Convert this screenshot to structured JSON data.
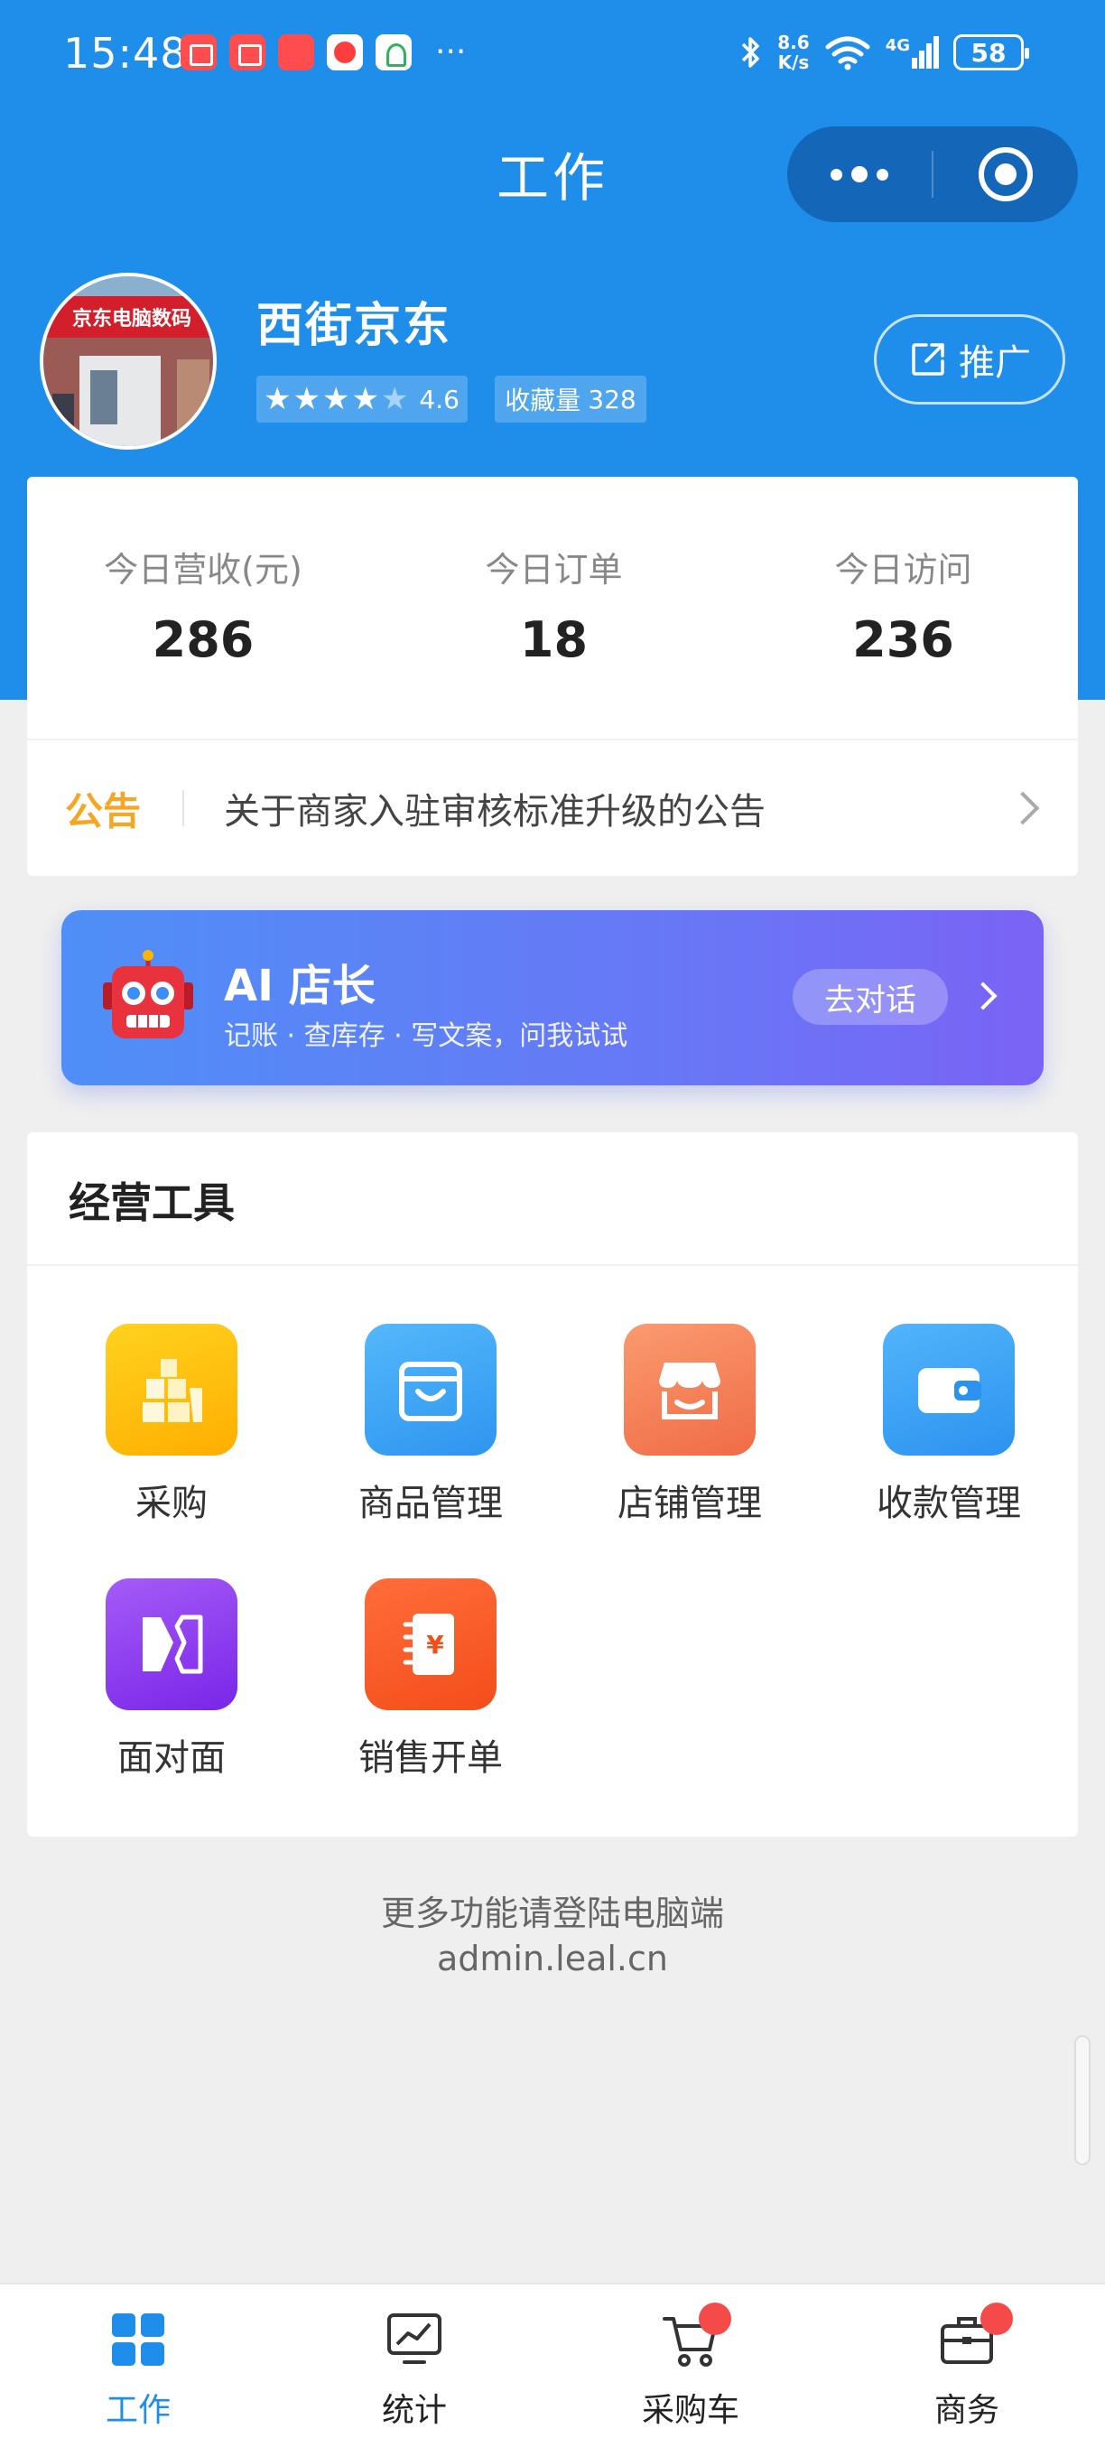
{
  "status_bar": {
    "time": "15:48",
    "more": "···",
    "net_speed_value": "8.6",
    "net_speed_unit": "K/s",
    "network": "4G",
    "battery": "58"
  },
  "header": {
    "title": "工作"
  },
  "shop": {
    "name": "西街京东",
    "avatar_text": "京东电脑数码",
    "rating": "4.6",
    "stars_filled": 4,
    "favorites_label": "收藏量",
    "favorites_count": "328",
    "promote_label": "推广"
  },
  "stats": [
    {
      "label": "今日营收(元)",
      "value": "286"
    },
    {
      "label": "今日订单",
      "value": "18"
    },
    {
      "label": "今日访问",
      "value": "236"
    }
  ],
  "notice": {
    "tag": "公告",
    "text": "关于商家入驻审核标准升级的公告"
  },
  "ai_banner": {
    "title": "AI 店长",
    "subtitle": "记账 · 查库存 · 写文案，问我试试",
    "button": "去对话"
  },
  "tools": {
    "title": "经营工具",
    "items": [
      {
        "label": "采购",
        "icon": "box-stack-icon",
        "color": "#FFC107"
      },
      {
        "label": "商品管理",
        "icon": "shopping-bag-icon",
        "color": "#3BA7F5"
      },
      {
        "label": "店铺管理",
        "icon": "storefront-icon",
        "color": "#F47F58"
      },
      {
        "label": "收款管理",
        "icon": "wallet-icon",
        "color": "#36A2F4"
      },
      {
        "label": "面对面",
        "icon": "face-to-face-icon",
        "color": "#8B3CF0"
      },
      {
        "label": "销售开单",
        "icon": "receipt-yuan-icon",
        "color": "#FF5A24"
      }
    ]
  },
  "footer": {
    "line1": "更多功能请登陆电脑端",
    "line2": "admin.leal.cn"
  },
  "tab_bar": {
    "items": [
      {
        "label": "工作",
        "active": true
      },
      {
        "label": "统计",
        "active": false
      },
      {
        "label": "采购车",
        "active": false,
        "badge": true
      },
      {
        "label": "商务",
        "active": false,
        "badge": true
      }
    ]
  },
  "colors": {
    "primary": "#1E8EEA",
    "notice_tag": "#F5A623",
    "badge": "#F44A4A"
  }
}
